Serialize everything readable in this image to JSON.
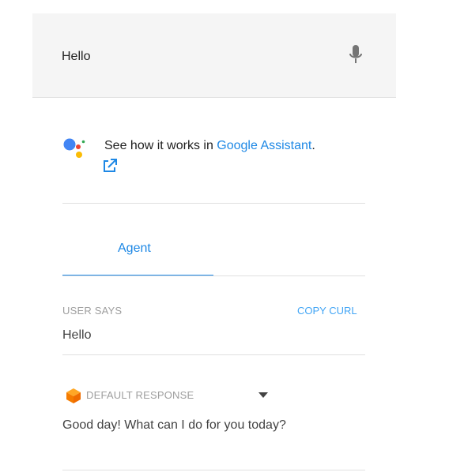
{
  "query_input": {
    "value": "Hello",
    "mic_icon": "mic-icon"
  },
  "assistant_promo": {
    "text_prefix": "See how it works in ",
    "link_text": "Google Assistant",
    "text_suffix": ".",
    "logo_icon": "google-assistant-logo",
    "external_icon": "external-link-icon"
  },
  "tabs": [
    {
      "label": "Agent",
      "active": true
    }
  ],
  "user_says": {
    "label": "USER SAYS",
    "copy_curl_label": "COPY CURL",
    "value": "Hello"
  },
  "default_response": {
    "label": "DEFAULT RESPONSE",
    "icon": "cube-icon",
    "dropdown_icon": "caret-down-icon",
    "value": "Good day! What can I do for you today?"
  },
  "colors": {
    "accent": "#1e88e5",
    "response_icon": "#f57c00",
    "input_bg": "#f5f5f5"
  }
}
